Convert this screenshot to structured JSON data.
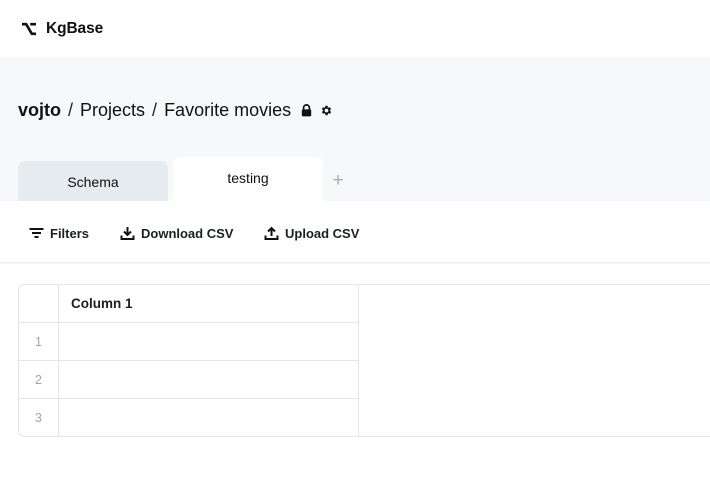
{
  "app": {
    "name": "KgBase",
    "logo_icon": "kgbase-logo-icon"
  },
  "breadcrumb": {
    "owner": "vojto",
    "sep1": "/",
    "projects": "Projects",
    "sep2": "/",
    "project": "Favorite movies",
    "lock_icon": "lock-icon",
    "settings_icon": "gear-icon"
  },
  "tabs": [
    {
      "label": "Schema",
      "active": false
    },
    {
      "label": "testing",
      "active": true
    }
  ],
  "add_tab": {
    "label": "+"
  },
  "toolbar": {
    "filters_label": "Filters",
    "download_label": "Download CSV",
    "upload_label": "Upload CSV"
  },
  "table": {
    "columns": [
      "Column 1"
    ],
    "rows": [
      {
        "index": "1",
        "values": [
          ""
        ]
      },
      {
        "index": "2",
        "values": [
          ""
        ]
      },
      {
        "index": "3",
        "values": [
          ""
        ]
      }
    ]
  },
  "colors": {
    "tab_inactive_bg": "#e6ebf0",
    "page_bg": "#f7f8fa",
    "border": "#e2e5e9"
  }
}
